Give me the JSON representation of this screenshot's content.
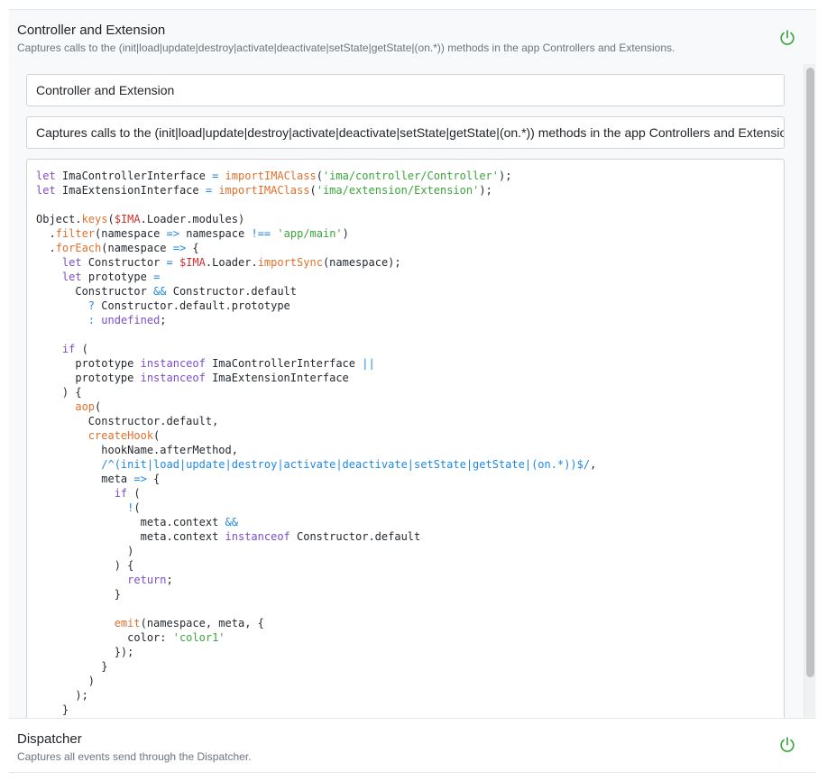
{
  "colors": {
    "power_on": "#3ba53b",
    "keyword": "#7c4dcc",
    "function": "#e0702c",
    "string": "#3ba53b",
    "operator": "#1e88e5",
    "variable": "#d32f2f",
    "regex": "#1e88e5"
  },
  "plugins": [
    {
      "title": "Controller and Extension",
      "description": "Captures calls to the (init|load|update|destroy|activate|deactivate|setState|getState|(on.*)) methods in the app Controllers and Extensions.",
      "enabled": true,
      "icon": "power-icon",
      "expanded": true,
      "name_value": "Controller and Extension",
      "description_value": "Captures calls to the (init|load|update|destroy|activate|deactivate|setState|getState|(on.*)) methods in the app Controllers and Extensions.",
      "code_lines": [
        [
          [
            "kw",
            "let"
          ],
          [
            "pl",
            " ImaControllerInterface "
          ],
          [
            "op",
            "="
          ],
          [
            "pl",
            " "
          ],
          [
            "fn",
            "importIMAClass"
          ],
          [
            "pl",
            "("
          ],
          [
            "str",
            "'ima/controller/Controller'"
          ],
          [
            "pl",
            ");"
          ]
        ],
        [
          [
            "kw",
            "let"
          ],
          [
            "pl",
            " ImaExtensionInterface "
          ],
          [
            "op",
            "="
          ],
          [
            "pl",
            " "
          ],
          [
            "fn",
            "importIMAClass"
          ],
          [
            "pl",
            "("
          ],
          [
            "str",
            "'ima/extension/Extension'"
          ],
          [
            "pl",
            ");"
          ]
        ],
        [],
        [
          [
            "pl",
            "Object."
          ],
          [
            "fn",
            "keys"
          ],
          [
            "pl",
            "("
          ],
          [
            "var",
            "$IMA"
          ],
          [
            "pl",
            ".Loader.modules)"
          ]
        ],
        [
          [
            "pl",
            "  ."
          ],
          [
            "fn",
            "filter"
          ],
          [
            "pl",
            "(namespace "
          ],
          [
            "op",
            "=>"
          ],
          [
            "pl",
            " namespace "
          ],
          [
            "op",
            "!=="
          ],
          [
            "pl",
            " "
          ],
          [
            "str",
            "'app/main'"
          ],
          [
            "pl",
            ")"
          ]
        ],
        [
          [
            "pl",
            "  ."
          ],
          [
            "fn",
            "forEach"
          ],
          [
            "pl",
            "(namespace "
          ],
          [
            "op",
            "=>"
          ],
          [
            "pl",
            " {"
          ]
        ],
        [
          [
            "pl",
            "    "
          ],
          [
            "kw",
            "let"
          ],
          [
            "pl",
            " Constructor "
          ],
          [
            "op",
            "="
          ],
          [
            "pl",
            " "
          ],
          [
            "var",
            "$IMA"
          ],
          [
            "pl",
            ".Loader."
          ],
          [
            "fn",
            "importSync"
          ],
          [
            "pl",
            "(namespace);"
          ]
        ],
        [
          [
            "pl",
            "    "
          ],
          [
            "kw",
            "let"
          ],
          [
            "pl",
            " prototype "
          ],
          [
            "op",
            "="
          ]
        ],
        [
          [
            "pl",
            "      Constructor "
          ],
          [
            "op",
            "&&"
          ],
          [
            "pl",
            " Constructor.default"
          ]
        ],
        [
          [
            "pl",
            "        "
          ],
          [
            "op",
            "?"
          ],
          [
            "pl",
            " Constructor.default.prototype"
          ]
        ],
        [
          [
            "pl",
            "        "
          ],
          [
            "op",
            ":"
          ],
          [
            "pl",
            " "
          ],
          [
            "kw",
            "undefined"
          ],
          [
            "pl",
            ";"
          ]
        ],
        [],
        [
          [
            "pl",
            "    "
          ],
          [
            "kw",
            "if"
          ],
          [
            "pl",
            " ("
          ]
        ],
        [
          [
            "pl",
            "      prototype "
          ],
          [
            "kw",
            "instanceof"
          ],
          [
            "pl",
            " ImaControllerInterface "
          ],
          [
            "op",
            "||"
          ]
        ],
        [
          [
            "pl",
            "      prototype "
          ],
          [
            "kw",
            "instanceof"
          ],
          [
            "pl",
            " ImaExtensionInterface"
          ]
        ],
        [
          [
            "pl",
            "    ) {"
          ]
        ],
        [
          [
            "pl",
            "      "
          ],
          [
            "fn",
            "aop"
          ],
          [
            "pl",
            "("
          ]
        ],
        [
          [
            "pl",
            "        Constructor.default,"
          ]
        ],
        [
          [
            "pl",
            "        "
          ],
          [
            "fn",
            "createHook"
          ],
          [
            "pl",
            "("
          ]
        ],
        [
          [
            "pl",
            "          hookName.afterMethod,"
          ]
        ],
        [
          [
            "pl",
            "          "
          ],
          [
            "rx",
            "/^(init|load|update|destroy|activate|deactivate|setState|getState|(on.*))$/"
          ],
          [
            "pl",
            ","
          ]
        ],
        [
          [
            "pl",
            "          meta "
          ],
          [
            "op",
            "=>"
          ],
          [
            "pl",
            " {"
          ]
        ],
        [
          [
            "pl",
            "            "
          ],
          [
            "kw",
            "if"
          ],
          [
            "pl",
            " ("
          ]
        ],
        [
          [
            "pl",
            "              "
          ],
          [
            "op",
            "!"
          ],
          [
            "pl",
            "("
          ]
        ],
        [
          [
            "pl",
            "                meta.context "
          ],
          [
            "op",
            "&&"
          ]
        ],
        [
          [
            "pl",
            "                meta.context "
          ],
          [
            "kw",
            "instanceof"
          ],
          [
            "pl",
            " Constructor.default"
          ]
        ],
        [
          [
            "pl",
            "              )"
          ]
        ],
        [
          [
            "pl",
            "            ) {"
          ]
        ],
        [
          [
            "pl",
            "              "
          ],
          [
            "kw",
            "return"
          ],
          [
            "pl",
            ";"
          ]
        ],
        [
          [
            "pl",
            "            }"
          ]
        ],
        [],
        [
          [
            "pl",
            "            "
          ],
          [
            "fn",
            "emit"
          ],
          [
            "pl",
            "(namespace, meta, {"
          ]
        ],
        [
          [
            "pl",
            "              color: "
          ],
          [
            "str",
            "'color1'"
          ]
        ],
        [
          [
            "pl",
            "            });"
          ]
        ],
        [
          [
            "pl",
            "          }"
          ]
        ],
        [
          [
            "pl",
            "        )"
          ]
        ],
        [
          [
            "pl",
            "      );"
          ]
        ],
        [
          [
            "pl",
            "    }"
          ]
        ]
      ]
    },
    {
      "title": "Dispatcher",
      "description": "Captures all events send through the Dispatcher.",
      "enabled": true,
      "icon": "power-icon",
      "expanded": false
    }
  ]
}
